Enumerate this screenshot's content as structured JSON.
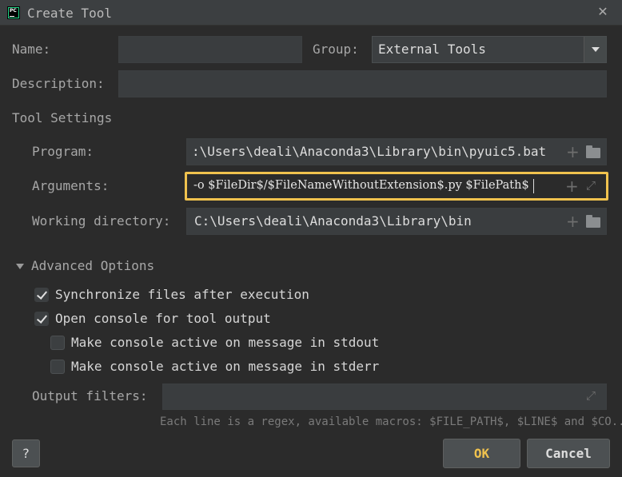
{
  "window": {
    "title": "Create Tool",
    "app_icon_text": "PC"
  },
  "form": {
    "name_label": "Name:",
    "name_value": "",
    "group_label": "Group:",
    "group_value": "External Tools",
    "description_label": "Description:",
    "description_value": ""
  },
  "tool_settings": {
    "heading": "Tool Settings",
    "program_label": "Program:",
    "program_value": ":\\Users\\deali\\Anaconda3\\Library\\bin\\pyuic5.bat",
    "arguments_label": "Arguments:",
    "arguments_value": "-o $FileDir$/$FileNameWithoutExtension$.py $FilePath$",
    "working_dir_label": "Working directory:",
    "working_dir_value": "C:\\Users\\deali\\Anaconda3\\Library\\bin"
  },
  "advanced": {
    "heading": "Advanced Options",
    "options": [
      {
        "label": "Synchronize files after execution",
        "checked": true
      },
      {
        "label": "Open console for tool output",
        "checked": true
      },
      {
        "label": "Make console active on message in stdout",
        "checked": false
      },
      {
        "label": "Make console active on message in stderr",
        "checked": false
      }
    ],
    "output_filters_label": "Output filters:",
    "output_filters_value": "",
    "hint": "Each line is a regex, available macros: $FILE_PATH$, $LINE$ and $CO..."
  },
  "footer": {
    "help_label": "?",
    "ok_label": "OK",
    "cancel_label": "Cancel"
  },
  "colors": {
    "background": "#2b2b2b",
    "focus_border": "#f0c24e",
    "ok_text": "#f0c24e"
  }
}
